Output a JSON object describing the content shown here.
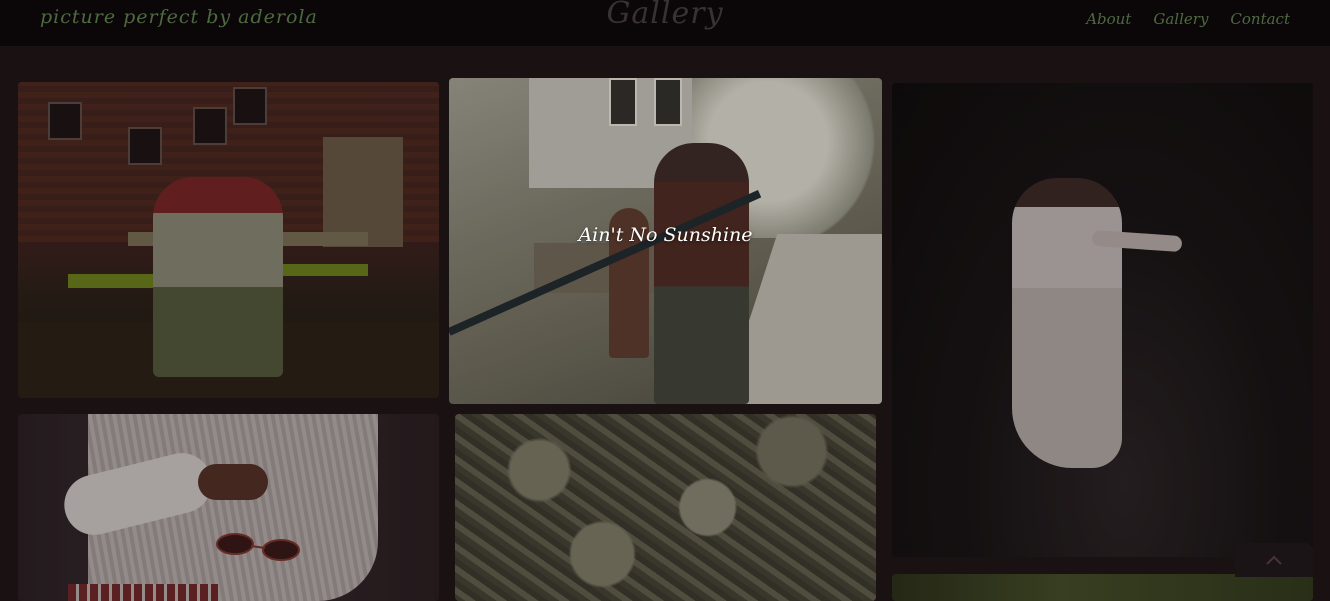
{
  "site": {
    "brand": "picture perfect by aderola",
    "page_title": "Gallery",
    "nav": [
      "About",
      "Gallery",
      "Contact"
    ]
  },
  "gallery": {
    "hover_caption": "Ain't No Sunshine",
    "photos": [
      {
        "name": "photo-woman-green-bench"
      },
      {
        "name": "photo-aint-no-sunshine"
      },
      {
        "name": "photo-woman-white-dress"
      },
      {
        "name": "photo-white-sweater-sunglasses"
      },
      {
        "name": "photo-flowering-tree"
      },
      {
        "name": "photo-green-foliage"
      }
    ]
  },
  "controls": {
    "scroll_top_icon": "chevron-up-icon"
  },
  "colors": {
    "background": "#1a1113",
    "header": "#0b0708",
    "accent_green": "#4e6a41"
  }
}
